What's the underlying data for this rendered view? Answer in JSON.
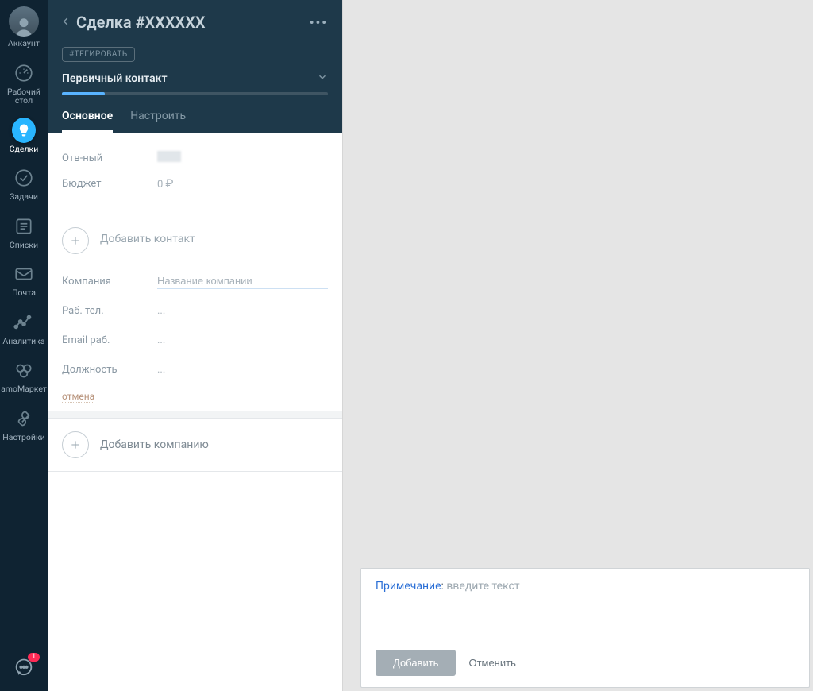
{
  "sidebar": {
    "items": [
      {
        "label": "Аккаунт",
        "icon": "avatar"
      },
      {
        "label": "Рабочий стол",
        "icon": "gauge"
      },
      {
        "label": "Сделки",
        "icon": "deals",
        "active": true
      },
      {
        "label": "Задачи",
        "icon": "check"
      },
      {
        "label": "Списки",
        "icon": "list"
      },
      {
        "label": "Почта",
        "icon": "mail"
      },
      {
        "label": "Аналитика",
        "icon": "analytics"
      },
      {
        "label": "amoМаркет",
        "icon": "market"
      },
      {
        "label": "Настройки",
        "icon": "settings"
      }
    ],
    "notif_count": "1"
  },
  "header": {
    "title": "Сделка #XXXXXX",
    "tag_label": "#ТЕГИРОВАТЬ",
    "pipeline": "Первичный контакт",
    "tabs": [
      {
        "label": "Основное",
        "active": true
      },
      {
        "label": "Настроить",
        "active": false
      }
    ]
  },
  "fields": {
    "responsible_label": "Отв-ный",
    "budget_label": "Бюджет",
    "budget_value": "0",
    "currency": "₽",
    "add_contact": "Добавить контакт",
    "company_label": "Компания",
    "company_placeholder": "Название компании",
    "work_phone_label": "Раб. тел.",
    "work_email_label": "Email раб.",
    "position_label": "Должность",
    "ellipsis": "...",
    "cancel": "отмена",
    "add_company": "Добавить компанию"
  },
  "note": {
    "type_label": "Примечание",
    "placeholder": "введите текст",
    "add_btn": "Добавить",
    "cancel_btn": "Отменить"
  }
}
